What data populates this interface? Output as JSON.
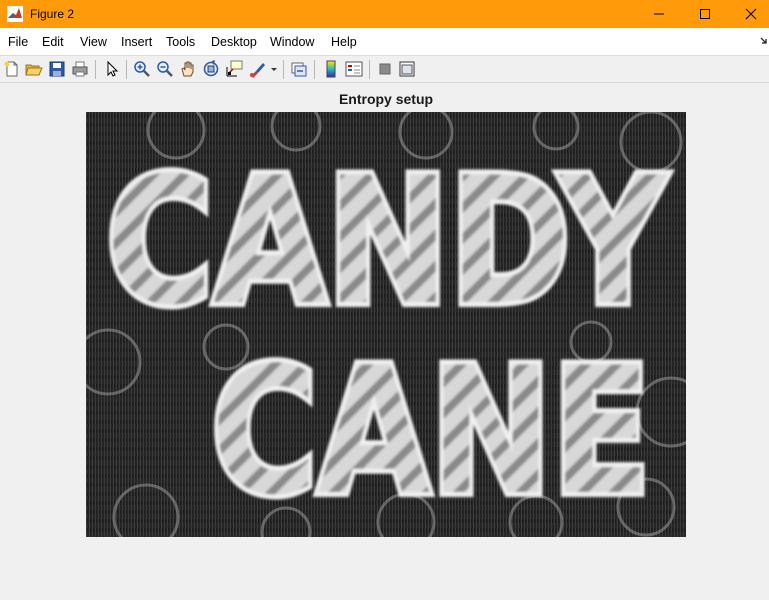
{
  "window": {
    "title": "Figure 2",
    "titlebar_color": "#ff9a0a"
  },
  "menu": {
    "items": [
      "File",
      "Edit",
      "View",
      "Insert",
      "Tools",
      "Desktop",
      "Window",
      "Help"
    ]
  },
  "toolbar": {
    "icons": [
      "new-figure-icon",
      "open-file-icon",
      "save-icon",
      "print-icon",
      "edit-plot-arrow-icon",
      "zoom-in-icon",
      "zoom-out-icon",
      "pan-hand-icon",
      "rotate-3d-icon",
      "data-cursor-icon",
      "brush-icon",
      "brush-dropdown-icon",
      "link-plot-icon",
      "insert-colorbar-icon",
      "insert-legend-icon",
      "hide-plot-tools-icon",
      "show-plot-tools-icon"
    ]
  },
  "figure": {
    "title": "Entropy setup",
    "image_text_line1": "CANDY",
    "image_text_line2": "CANE"
  }
}
